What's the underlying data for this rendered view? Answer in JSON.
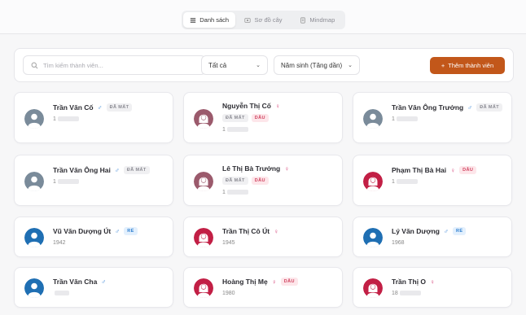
{
  "view_tabs": [
    {
      "label": "Danh sách",
      "icon": "list-icon",
      "active": true
    },
    {
      "label": "Sơ đồ cây",
      "icon": "tree-icon",
      "active": false
    },
    {
      "label": "Mindmap",
      "icon": "mindmap-icon",
      "active": false
    }
  ],
  "filters": {
    "search_placeholder": "Tìm kiếm thành viên...",
    "status_value": "Tất cả",
    "sort_value": "Năm sinh (Tăng dần)",
    "add_button": "Thêm thành viên",
    "add_icon": "+"
  },
  "labels": {
    "dead": "ĐÃ MẤT",
    "dau": "DÂU",
    "re": "RỂ"
  },
  "colors": {
    "accent": "#c2571a",
    "avatar_gray": "#7a8b9a",
    "avatar_mauve": "#9b5a6c",
    "avatar_red": "#c21f45",
    "avatar_blue": "#1f6fb3"
  },
  "members": [
    {
      "name": "Trần Văn Cố",
      "gender": "♂",
      "gender_type": "male",
      "badges": [
        "dead"
      ],
      "year": "1",
      "year_hidden": true,
      "avatar": "gray"
    },
    {
      "name": "Nguyễn Thị Cố",
      "gender": "♀",
      "gender_type": "female",
      "badges": [
        "dead",
        "dau"
      ],
      "year": "1",
      "year_hidden": true,
      "avatar": "mauve"
    },
    {
      "name": "Trần Văn Ông Trưởng",
      "gender": "♂",
      "gender_type": "male",
      "badges": [
        "dead"
      ],
      "year": "1",
      "year_hidden": true,
      "avatar": "gray"
    },
    {
      "name": "Trần Văn Ông Hai",
      "gender": "♂",
      "gender_type": "male",
      "badges": [
        "dead"
      ],
      "year": "1",
      "year_hidden": true,
      "avatar": "gray"
    },
    {
      "name": "Lê Thị Bà Trưởng",
      "gender": "♀",
      "gender_type": "female",
      "badges": [
        "dead",
        "dau"
      ],
      "year": "1",
      "year_hidden": true,
      "avatar": "mauve"
    },
    {
      "name": "Phạm Thị Bà Hai",
      "gender": "♀",
      "gender_type": "female",
      "badges": [
        "dau"
      ],
      "year": "1",
      "year_hidden": true,
      "avatar": "red"
    },
    {
      "name": "Vũ Văn Dượng Út",
      "gender": "♂",
      "gender_type": "male",
      "badges": [
        "re"
      ],
      "year": "1942",
      "year_hidden": false,
      "avatar": "blue"
    },
    {
      "name": "Trần Thị Cô Út",
      "gender": "♀",
      "gender_type": "female",
      "badges": [],
      "year": "1945",
      "year_hidden": false,
      "avatar": "red"
    },
    {
      "name": "Lý Văn Dượng",
      "gender": "♂",
      "gender_type": "male",
      "badges": [
        "re"
      ],
      "year": "1968",
      "year_hidden": false,
      "avatar": "blue"
    },
    {
      "name": "Trần Văn Cha",
      "gender": "♂",
      "gender_type": "male",
      "badges": [],
      "year": "",
      "year_hidden": true,
      "avatar": "blue"
    },
    {
      "name": "Hoàng Thị Mẹ",
      "gender": "♀",
      "gender_type": "female",
      "badges": [
        "dau"
      ],
      "year": "1980",
      "year_hidden": false,
      "avatar": "red"
    },
    {
      "name": "Trần Thị O",
      "gender": "♀",
      "gender_type": "female",
      "badges": [],
      "year": "18",
      "year_hidden": true,
      "avatar": "red"
    }
  ]
}
